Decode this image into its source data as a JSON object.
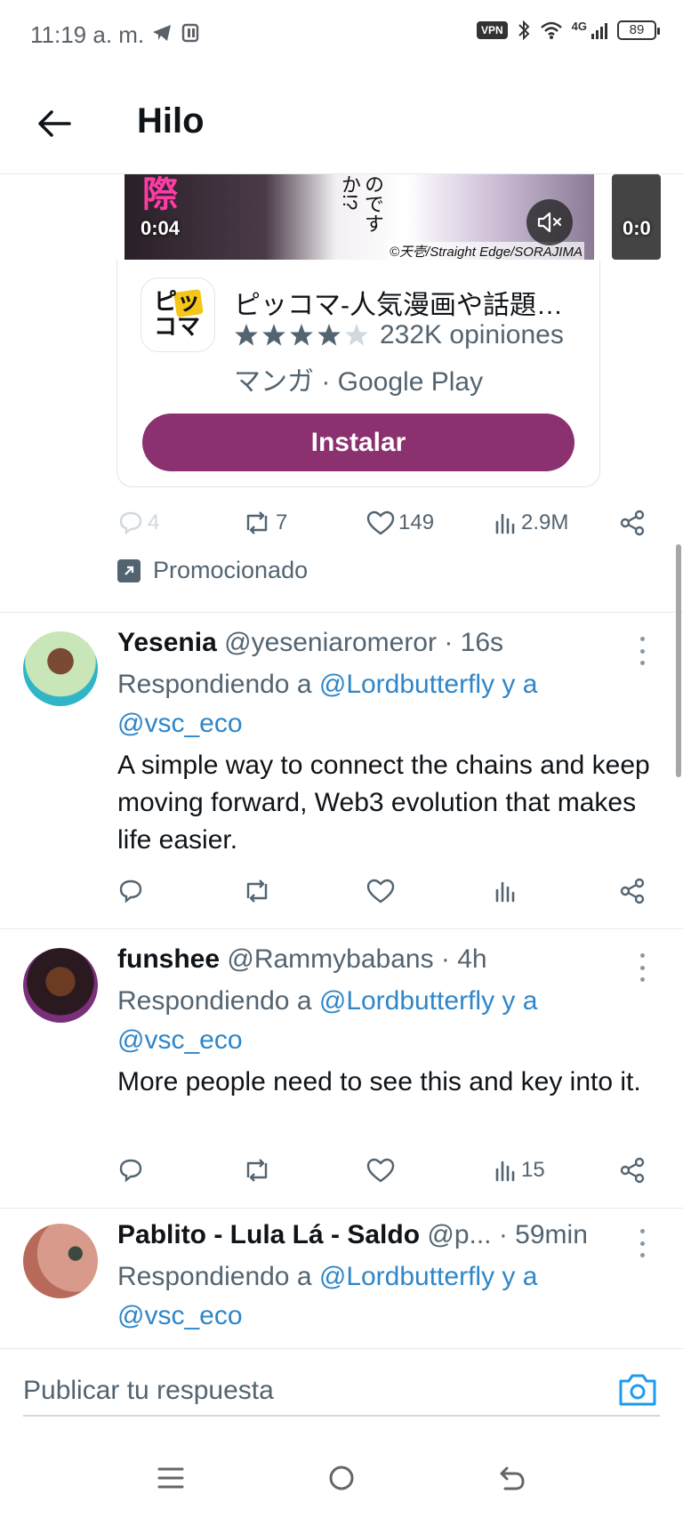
{
  "status_bar": {
    "time": "11:19 a. m.",
    "vpn": "VPN",
    "network": "4G",
    "battery": "89"
  },
  "header": {
    "title": "Hilo",
    "back_icon": "arrow-left-icon"
  },
  "ad": {
    "media": {
      "duration": "0:04",
      "next_duration": "0:0",
      "credit": "©天壱/Straight Edge/SORAJIMA",
      "overlay_kanji": "際",
      "overlay_text": "のですか!?",
      "mute_icon": "volume-mute-icon"
    },
    "app": {
      "logo_text": "ピッコマ",
      "name": "ピッコマ-人気漫画や話題…",
      "rating_stars": 4.3,
      "reviews": "232K opiniones",
      "store": "マンガ · Google Play",
      "install_label": "Instalar"
    },
    "actions": {
      "replies": "4",
      "reposts": "7",
      "likes": "149",
      "views": "2.9M"
    },
    "promoted_label": "Promocionado"
  },
  "replies": [
    {
      "name": "Yesenia",
      "handle": "@yeseniaromeror · 16s",
      "replying_prefix": "Respondiendo a",
      "replying_to": "@Lordbutterfly y a",
      "replying_to2": "@vsc_eco",
      "text": "A simple way to connect the chains and keep moving forward, Web3 evolution that makes life easier.",
      "views": ""
    },
    {
      "name": "funshee",
      "handle": "@Rammybabans · 4h",
      "replying_prefix": "Respondiendo a",
      "replying_to": "@Lordbutterfly y a",
      "replying_to2": "@vsc_eco",
      "text": "More people need to see this and key into it.",
      "views": "15"
    },
    {
      "name": "Pablito - Lula Lá - Saldo",
      "handle": "@p... · 59min",
      "replying_prefix": "Respondiendo a",
      "replying_to": "@Lordbutterfly y a",
      "replying_to2": "@vsc_eco"
    }
  ],
  "composer": {
    "placeholder": "Publicar tu respuesta",
    "camera_icon": "camera-icon"
  },
  "colors": {
    "accent": "#1d9bf0",
    "install_button": "#8c3170",
    "secondary_text": "#536471"
  }
}
